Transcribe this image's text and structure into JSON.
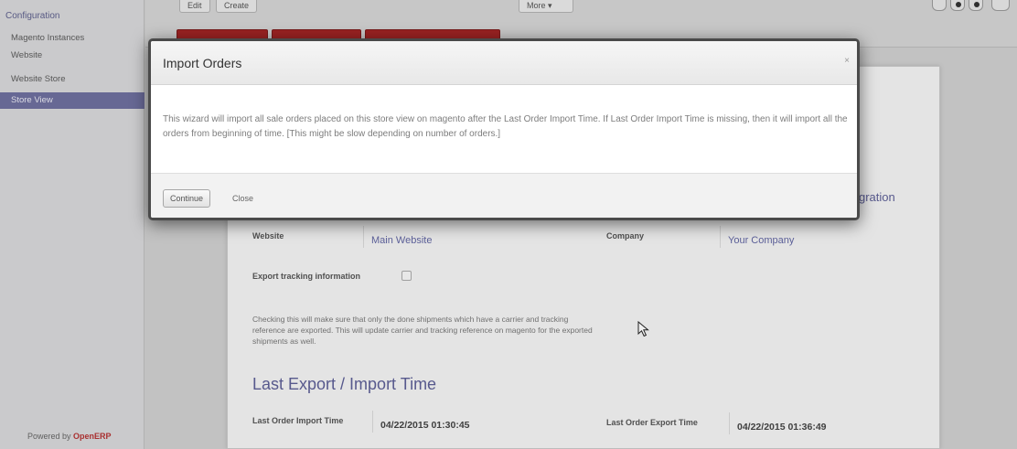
{
  "sidebar": {
    "header": "Configuration",
    "items": [
      {
        "label": "Magento Instances"
      },
      {
        "label": "Website"
      },
      {
        "label": "Website Store"
      },
      {
        "label": "Store View"
      }
    ],
    "powered_by_prefix": "Powered by",
    "powered_by_brand": "OpenERP"
  },
  "toolbar": {
    "edit_label": "Edit",
    "create_label": "Create",
    "more_label": "More ▾"
  },
  "form": {
    "partial_heading": "gration",
    "website_label": "Website",
    "website_value": "Main Website",
    "company_label": "Company",
    "company_value": "Your Company",
    "export_tracking_label": "Export tracking information",
    "help_text": "Checking this will make sure that only the done shipments which have a carrier and tracking reference are exported. This will update carrier and tracking reference on magento for the exported shipments as well.",
    "section_title": "Last Export / Import Time",
    "last_import_label": "Last Order Import Time",
    "last_import_value": "04/22/2015 01:30:45",
    "last_export_label": "Last Order Export Time",
    "last_export_value": "04/22/2015 01:36:49"
  },
  "modal": {
    "title": "Import Orders",
    "close_glyph": "×",
    "body": "This wizard will import all sale orders placed on this store view on magento after the Last Order Import Time. If Last Order Import Time is missing, then it will import all the orders from beginning of time. [This might be slow depending on number of orders.]",
    "continue_label": "Continue",
    "close_label": "Close"
  },
  "colors": {
    "accent": "#6e6f9e",
    "state_button": "#a52525",
    "link_value": "#6266a3"
  }
}
